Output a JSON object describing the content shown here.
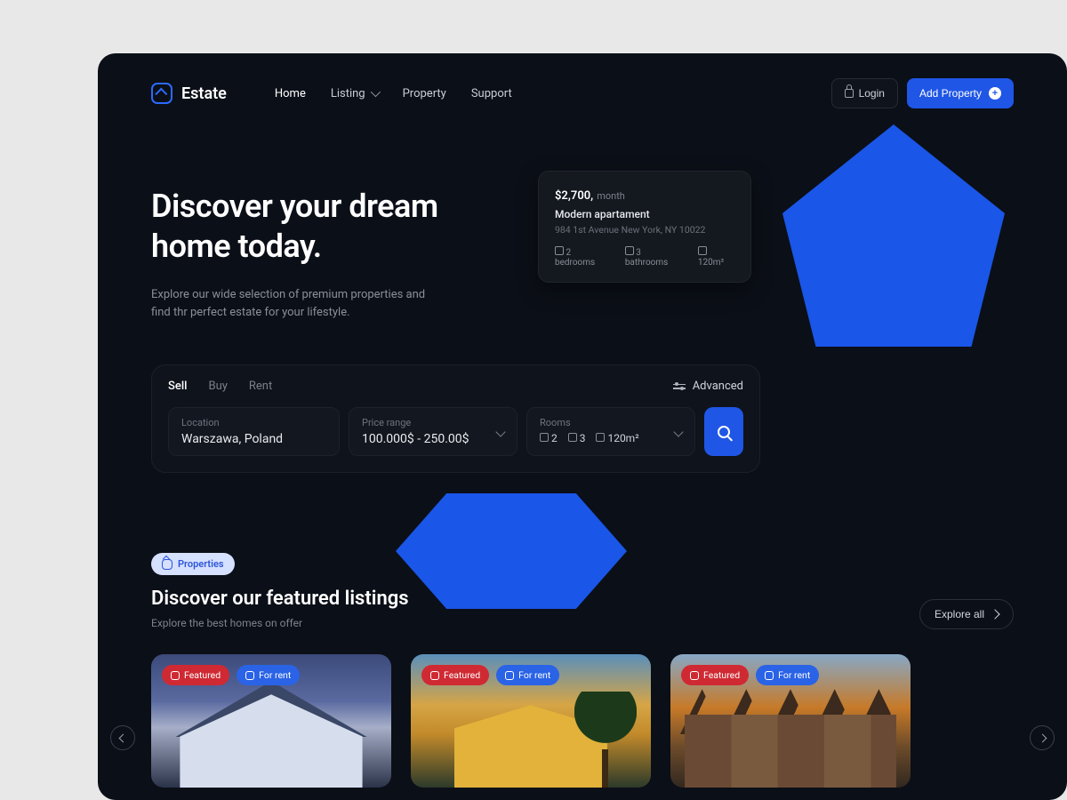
{
  "brand": "Estate",
  "nav": {
    "items": [
      "Home",
      "Listing",
      "Property",
      "Support"
    ]
  },
  "header": {
    "login": "Login",
    "add": "Add Property"
  },
  "hero": {
    "title_l1": "Discover your dream",
    "title_l2": "home today.",
    "subtitle": "Explore our wide selection of premium properties and find thr perfect estate for your lifestyle."
  },
  "preview_card": {
    "price": "$2,700,",
    "per": "month",
    "name": "Modern apartament",
    "address": "984 1st  Avenue New York, NY 10022",
    "beds": "2 bedrooms",
    "baths": "3 bathrooms",
    "area": "120m²"
  },
  "search": {
    "tabs": [
      "Sell",
      "Buy",
      "Rent"
    ],
    "advanced": "Advanced",
    "location": {
      "label": "Location",
      "value": "Warszawa, Poland"
    },
    "price": {
      "label": "Price range",
      "value": "100.000$ - 250.00$"
    },
    "rooms": {
      "label": "Rooms",
      "beds": "2",
      "baths": "3",
      "area": "120m²"
    }
  },
  "section": {
    "pill": "Properties",
    "title": "Discover our featured listings",
    "sub": "Explore the best homes on offer",
    "explore": "Explore all"
  },
  "tags": {
    "featured": "Featured",
    "for_rent": "For rent"
  }
}
